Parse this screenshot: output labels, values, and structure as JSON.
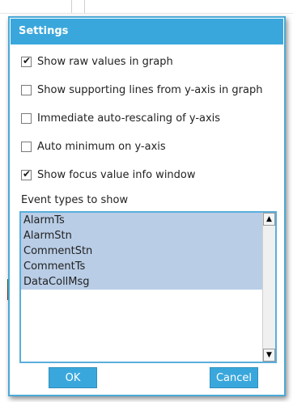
{
  "dialog": {
    "title": "Settings",
    "options": [
      {
        "label": "Show raw values in graph",
        "checked": true
      },
      {
        "label": "Show supporting lines from y-axis in graph",
        "checked": false
      },
      {
        "label": "Immediate auto-rescaling of y-axis",
        "checked": false
      },
      {
        "label": "Auto minimum on y-axis",
        "checked": false
      },
      {
        "label": "Show focus value info window",
        "checked": true
      }
    ],
    "event_types_label": "Event types to show",
    "event_types": [
      "AlarmTs",
      "AlarmStn",
      "CommentStn",
      "CommentTs",
      "DataCollMsg"
    ],
    "ok_label": "OK",
    "cancel_label": "Cancel"
  },
  "colors": {
    "accent": "#3aa7dc",
    "selection": "#b9cde6"
  },
  "icons": {
    "checked": "checkmark-icon",
    "scroll_up": "scroll-up-arrow-icon",
    "scroll_down": "scroll-down-arrow-icon"
  }
}
